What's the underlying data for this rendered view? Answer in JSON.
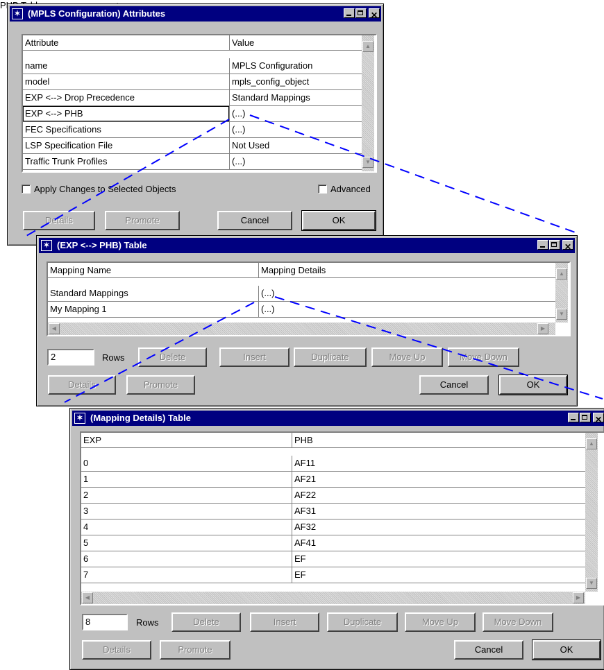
{
  "attributes_dialog": {
    "title": "(MPLS Configuration) Attributes",
    "header": {
      "col1": "Attribute",
      "col2": "Value"
    },
    "rows": [
      {
        "attribute": "name",
        "value": "MPLS Configuration"
      },
      {
        "attribute": "model",
        "value": "mpls_config_object"
      },
      {
        "attribute": "EXP <--> Drop Precedence",
        "value": "Standard Mappings"
      },
      {
        "attribute": "EXP <--> PHB",
        "value": "(...)"
      },
      {
        "attribute": "FEC Specifications",
        "value": "(...)"
      },
      {
        "attribute": "LSP Specification File",
        "value": "Not Used"
      },
      {
        "attribute": "Traffic Trunk Profiles",
        "value": "(...)"
      }
    ],
    "apply_changes_label": "Apply Changes to Selected Objects",
    "advanced_label": "Advanced",
    "buttons": {
      "details": "Details",
      "promote": "Promote",
      "cancel": "Cancel",
      "ok": "OK"
    }
  },
  "phb_dialog": {
    "title": "(EXP <--> PHB) Table",
    "header": {
      "col1": "Mapping Name",
      "col2": "Mapping Details"
    },
    "rows": [
      {
        "name": "Standard Mappings",
        "details": "(...)"
      },
      {
        "name": "My Mapping 1",
        "details": "(...)"
      }
    ],
    "rows_value": "2",
    "rows_label": "Rows",
    "buttons": {
      "delete": "Delete",
      "insert": "Insert",
      "duplicate": "Duplicate",
      "move_up": "Move Up",
      "move_down": "Move Down",
      "details": "Details",
      "promote": "Promote",
      "cancel": "Cancel",
      "ok": "OK"
    }
  },
  "mapping_dialog": {
    "title": "(Mapping Details) Table",
    "header": {
      "col1": "EXP",
      "col2": "PHB"
    },
    "rows": [
      {
        "exp": "0",
        "phb": "AF11"
      },
      {
        "exp": "1",
        "phb": "AF21"
      },
      {
        "exp": "2",
        "phb": "AF22"
      },
      {
        "exp": "3",
        "phb": "AF31"
      },
      {
        "exp": "4",
        "phb": "AF32"
      },
      {
        "exp": "5",
        "phb": "AF41"
      },
      {
        "exp": "6",
        "phb": "EF"
      },
      {
        "exp": "7",
        "phb": "EF"
      }
    ],
    "rows_value": "8",
    "rows_label": "Rows",
    "buttons": {
      "delete": "Delete",
      "insert": "Insert",
      "duplicate": "Duplicate",
      "move_up": "Move Up",
      "move_down": "Move Down",
      "details": "Details",
      "promote": "Promote",
      "cancel": "Cancel",
      "ok": "OK"
    }
  },
  "colors": {
    "titlebar": "#000080",
    "dialog_face": "#c0c0c0",
    "callout_line": "#0000ff"
  },
  "icons": {
    "app": "star-icon",
    "minimize": "minimize-icon",
    "maximize": "maximize-icon",
    "close": "close-icon"
  }
}
